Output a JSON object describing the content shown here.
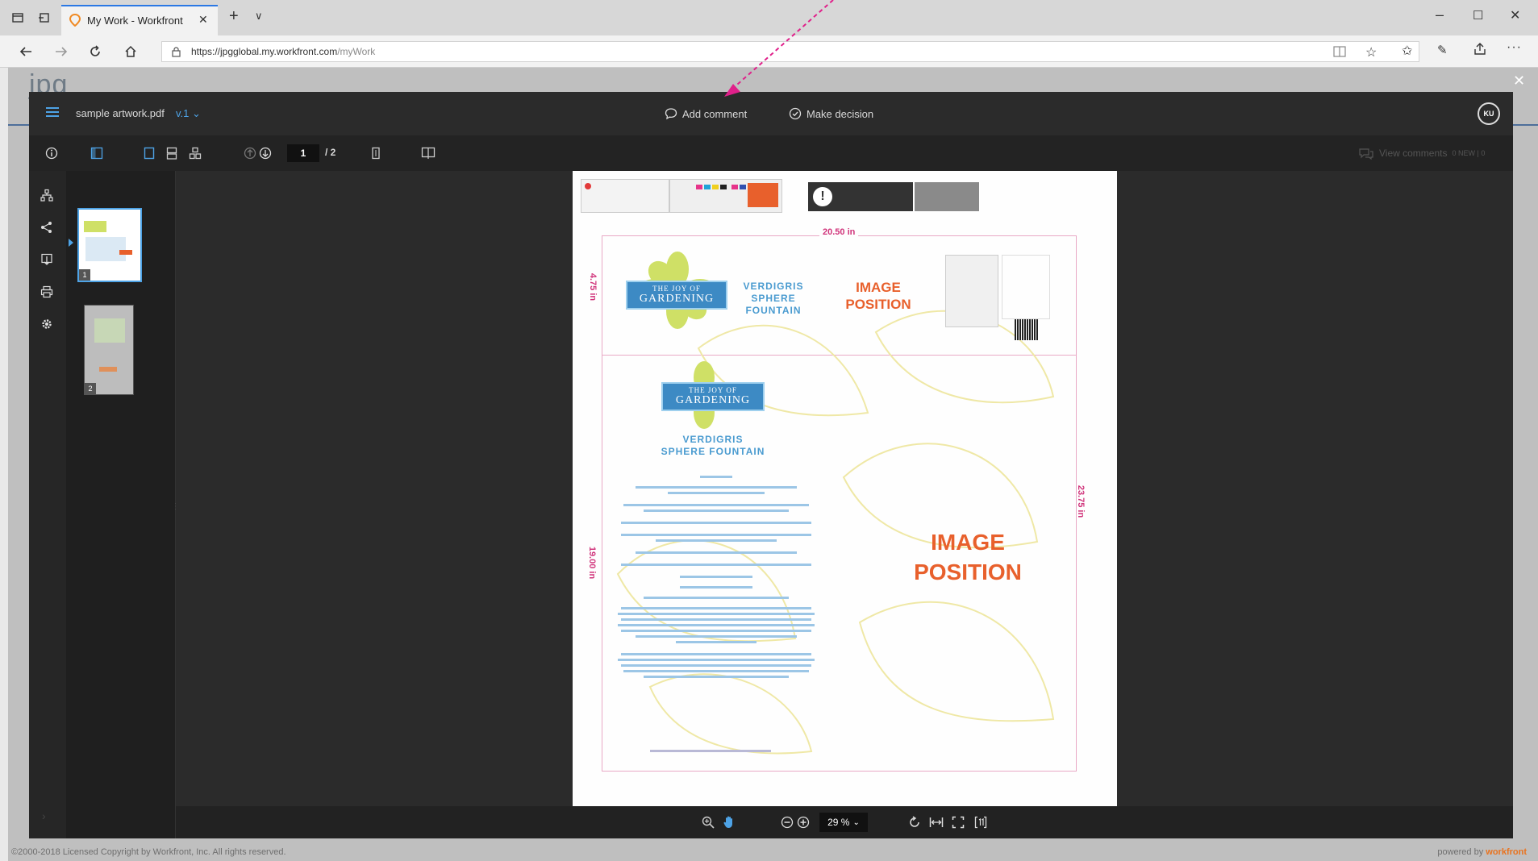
{
  "browser": {
    "tab_title": "My Work - Workfront",
    "tab_close": "✕",
    "new_tab": "+",
    "tab_menu": "∨",
    "url_host": "https://jpgglobal.my.workfront.com",
    "url_path": "/myWork",
    "win_min": "–",
    "win_max": "☐",
    "win_close": "✕"
  },
  "page": {
    "logo_partial": "jpg",
    "footer_copyright": "©2000-2018 Licensed Copyright by Workfront, Inc. All rights reserved.",
    "footer_powered": "powered by",
    "footer_brand": "workfront"
  },
  "viewer": {
    "file_name": "sample artwork.pdf",
    "version": "v.1",
    "add_comment": "Add comment",
    "make_decision": "Make decision",
    "avatar_initials": "KU",
    "close": "✕",
    "page_current": "1",
    "page_total": "/ 2",
    "view_comments": "View comments",
    "new_count": "0 NEW | 0",
    "zoom_level": "29 %"
  },
  "thumbnails": [
    {
      "number": "1",
      "selected": true
    },
    {
      "number": "2",
      "selected": false
    }
  ],
  "document": {
    "width_dim": "20.50 in",
    "top_height_dim": "4.75 in",
    "bottom_height_dim": "19.00 in",
    "right_height_dim": "23.75 in",
    "gardening_small": "THE JOY OF",
    "gardening_large": "GARDENING",
    "product_line1": "VERDIGRIS",
    "product_line2": "SPHERE",
    "product_line3": "FOUNTAIN",
    "product_full1": "VERDIGRIS",
    "product_full2": "SPHERE FOUNTAIN",
    "image_pos_1": "IMAGE",
    "image_pos_2": "POSITION",
    "image_pos_big1": "IMAGE",
    "image_pos_big2": "POSITION"
  },
  "colors": {
    "accent_blue": "#2b78e4",
    "dim_pink": "#d0337a",
    "image_orange": "#e8602c",
    "verdigris_blue": "#4a9bd0",
    "annotation_arrow": "#e0208a"
  }
}
